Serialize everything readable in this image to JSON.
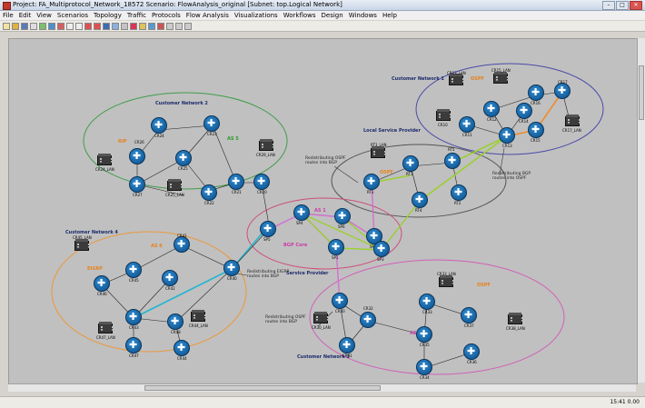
{
  "window": {
    "title": "Project: FA_Multiprotocol_Network_18572 Scenario: FlowAnalysis_original  [Subnet: top.Logical Network]"
  },
  "menu": [
    "File",
    "Edit",
    "View",
    "Scenarios",
    "Topology",
    "Traffic",
    "Protocols",
    "Flow Analysis",
    "Visualizations",
    "Workflows",
    "Design",
    "Windows",
    "Help"
  ],
  "labels": {
    "customer_network_1": "Customer Network 1",
    "customer_network_2": "Customer Network 2",
    "customer_network_3": "Customer Network 3",
    "customer_network_4": "Customer Network 4",
    "local_service_provider": "Local Service Provider",
    "service_provider": "Service Provider",
    "bgp_core": "BGP Core",
    "as1": "AS 1",
    "as5": "AS 5",
    "as6": "AS 6",
    "as7": "AS 7",
    "eigrp": "EIGRP",
    "ospf1": "OSPF",
    "ospf2": "OSPF",
    "ospf3": "OSPF",
    "rip": "RIP",
    "note_lsp": "Redistributing OSPF routes into BGP",
    "note_cn1": "Redistributing BGP routes into OSPF",
    "note_cn4": "Redistributing EIGRP routes into BGP",
    "note_cn3": "Redistributing OSPF routes into BGP"
  },
  "nodes": {
    "cr24": "CR24",
    "cr26": "CR26",
    "cr23": "CR23",
    "cr25": "CR25",
    "cr27": "CR27",
    "cr22": "CR22",
    "cr21": "CR21",
    "cr20": "CR20",
    "cr24_lan": "CR24_LAN",
    "cr25_lan": "CR25_LAN",
    "cr29_lan": "CR29_LAN",
    "cr13_lan": "CR13_LAN",
    "cr15_lan": "CR15_LAN",
    "cr16": "CR16",
    "cr17": "CR17",
    "cr11": "CR11",
    "cr12": "CR12",
    "cr14": "CR14",
    "cr13": "CR13",
    "cr15": "CR15",
    "cr10": "CR10",
    "cr17_lan": "CR17_LAN",
    "rt3_lan": "RT3_LAN",
    "rt1": "RT1",
    "rt2": "RT2",
    "rt3": "RT3",
    "rt4": "RT4",
    "rt5": "RT5",
    "sp1": "SP1",
    "sp2": "SP2",
    "sp3": "SP3",
    "sp4": "SP4",
    "sp5": "SP5",
    "sp6": "SP6",
    "cr45_lan": "CR45_LAN",
    "cr40": "CR40",
    "cr41": "CR41",
    "cr42": "CR42",
    "cr43": "CR43",
    "cr44": "CR44",
    "cr45": "CR45",
    "cr46": "CR46",
    "cr47": "CR47",
    "cr48": "CR48",
    "cr44_lan": "CR44_LAN",
    "cr47_lan": "CR47_LAN",
    "cr30": "CR30",
    "cr31": "CR31",
    "cr32": "CR32",
    "cr33": "CR33",
    "cr34": "CR34",
    "cr35": "CR35",
    "cr36": "CR36",
    "cr37": "CR37",
    "cr30_lan": "CR30_LAN",
    "cr33_lan": "CR33_LAN",
    "cr38_lan": "CR38_LAN"
  },
  "status": {
    "time": "15:41  0.00"
  }
}
